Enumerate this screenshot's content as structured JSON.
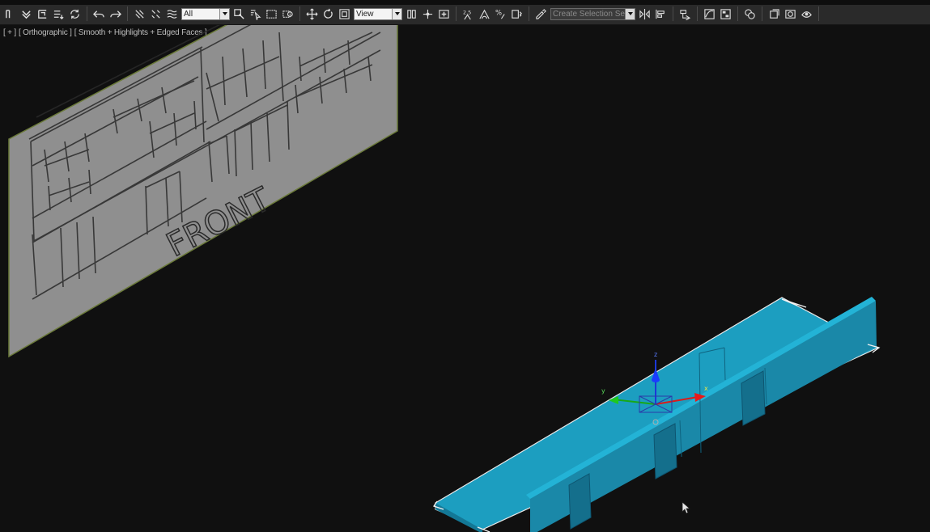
{
  "toolbar": {
    "selection_filter": "All",
    "reference_coordinate": "View",
    "named_selection_placeholder": "Create Selection Se",
    "accent_color": "#2a2a2a"
  },
  "viewport": {
    "view_plus": "[ + ]",
    "view_projection": "[ Orthographic ]",
    "view_shading": "[ Smooth + Highlights + Edged Faces ]",
    "background_color": "#101010"
  },
  "scene": {
    "sketch_plane_label": "FRONT",
    "model_color": "#1aa6c8",
    "gizmo_axes": {
      "x": "x",
      "y": "y",
      "z": "z"
    }
  },
  "icons": [
    "link-icon",
    "unlink-icon",
    "bind-spacewarp-icon",
    "undo-icon",
    "redo-icon",
    "select-object-icon",
    "select-by-name-icon",
    "rectangle-selection-icon",
    "window-crossing-icon",
    "select-move-icon",
    "select-rotate-icon",
    "select-scale-icon",
    "pivot-center-icon",
    "select-manipulate-icon",
    "snaps-toggle-icon",
    "angle-snap-icon",
    "percent-snap-icon",
    "spinner-snap-icon",
    "edit-named-selection-icon",
    "mirror-icon",
    "align-icon",
    "layer-manager-icon",
    "curve-editor-icon",
    "schematic-view-icon",
    "material-editor-icon",
    "render-setup-icon",
    "render-frame-icon",
    "render-icon"
  ]
}
